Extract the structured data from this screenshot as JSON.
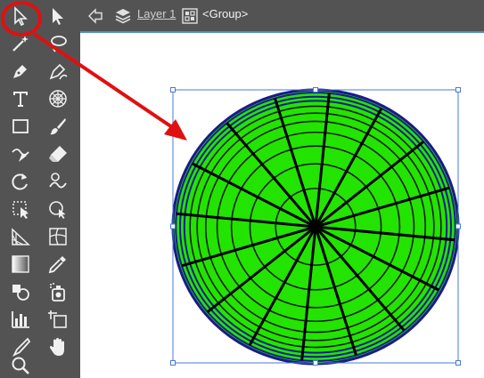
{
  "breadcrumb": {
    "layer_label": "Layer 1",
    "group_label": "<Group>"
  },
  "tools": [
    {
      "name": "selection-tool-icon"
    },
    {
      "name": "direct-selection-tool-icon"
    },
    {
      "name": "magic-wand-tool-icon"
    },
    {
      "name": "lasso-tool-icon"
    },
    {
      "name": "pen-tool-icon"
    },
    {
      "name": "curvature-tool-icon"
    },
    {
      "name": "type-tool-icon"
    },
    {
      "name": "polar-grid-tool-icon"
    },
    {
      "name": "rectangle-tool-icon"
    },
    {
      "name": "paintbrush-tool-icon"
    },
    {
      "name": "shaper-tool-icon"
    },
    {
      "name": "eraser-tool-icon"
    },
    {
      "name": "rotate-tool-icon"
    },
    {
      "name": "warp-tool-icon"
    },
    {
      "name": "free-transform-tool-icon"
    },
    {
      "name": "shape-builder-tool-icon"
    },
    {
      "name": "perspective-grid-tool-icon"
    },
    {
      "name": "mesh-tool-icon"
    },
    {
      "name": "gradient-tool-icon"
    },
    {
      "name": "eyedropper-tool-icon"
    },
    {
      "name": "blend-tool-icon"
    },
    {
      "name": "symbol-sprayer-tool-icon"
    },
    {
      "name": "column-graph-tool-icon"
    },
    {
      "name": "artboard-tool-icon"
    },
    {
      "name": "slice-tool-icon"
    },
    {
      "name": "hand-tool-icon"
    },
    {
      "name": "zoom-tool-icon"
    }
  ],
  "colors": {
    "fill": "#22e400",
    "stroke_outer": "#1a1a8c",
    "selection": "#4a7bd4",
    "annotation": "#e01010"
  }
}
